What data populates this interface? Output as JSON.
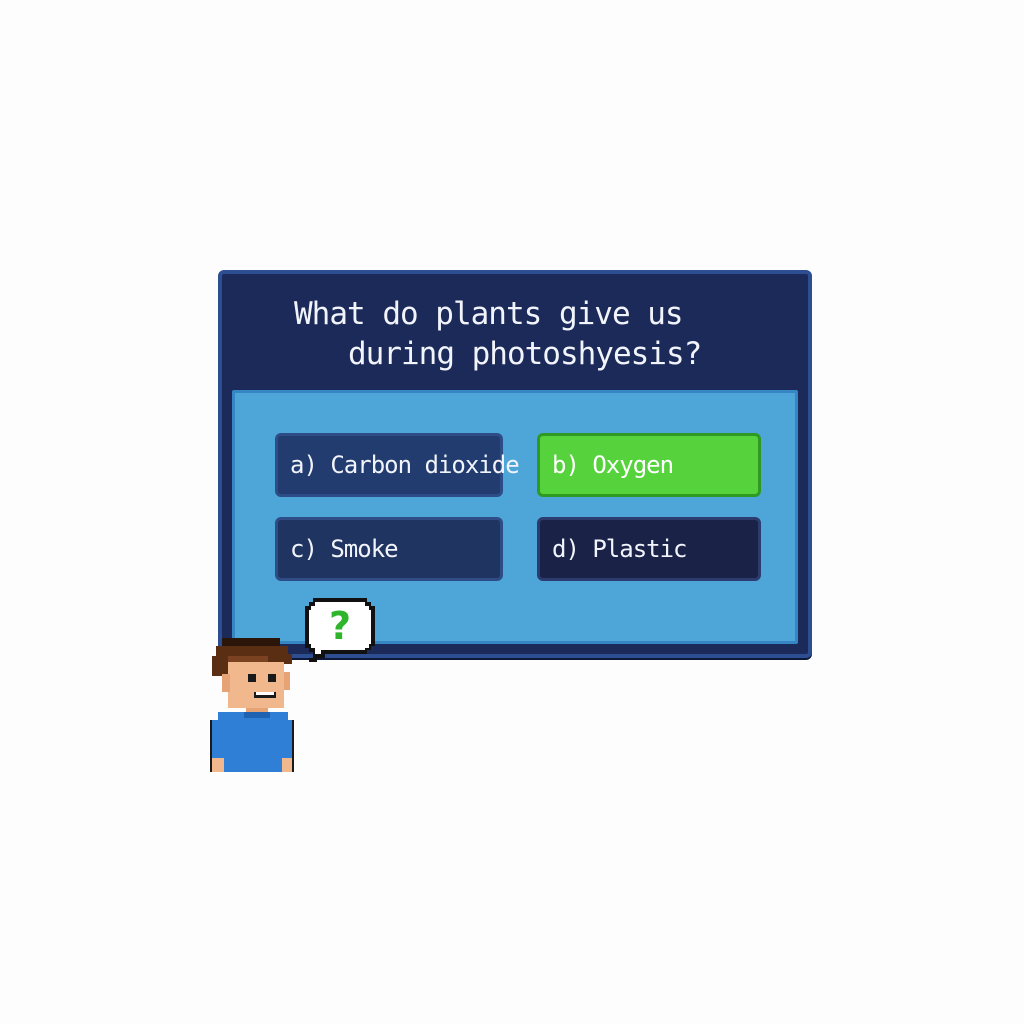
{
  "question": {
    "line1": "What do plants give us",
    "line2": "during photoshyesis?"
  },
  "options": [
    {
      "label": "a) Carbon dioxide",
      "state": "default"
    },
    {
      "label": "b) Oxygen",
      "state": "highlighted"
    },
    {
      "label": "c) Smoke",
      "state": "default"
    },
    {
      "label": "d) Plastic",
      "state": "default"
    }
  ],
  "hint_bubble": {
    "symbol": "?"
  },
  "colors": {
    "panel": "#1b2a58",
    "answer_area": "#4ea6d8",
    "highlight": "#56d33c",
    "question_mark": "#2fb52b"
  },
  "icons": {
    "character": "pixel-boy-icon",
    "bubble": "speech-bubble-icon"
  }
}
